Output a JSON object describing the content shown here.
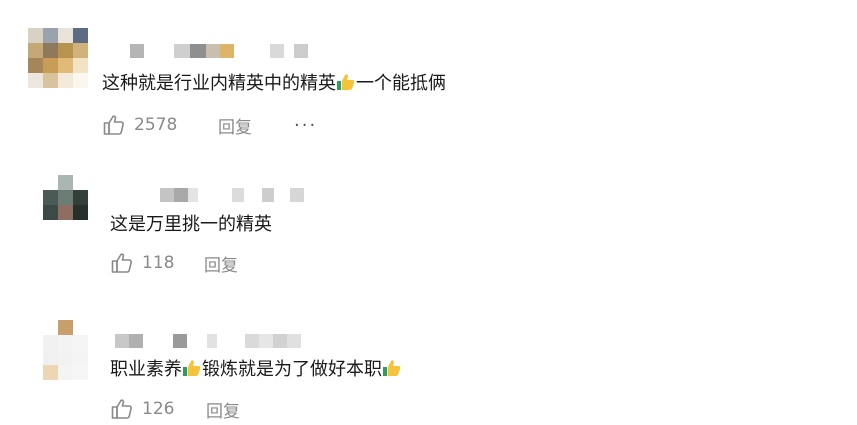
{
  "comments": [
    {
      "text_parts": [
        "这种就是行业内精英中的精英",
        "一个能抵俩"
      ],
      "likes": "2578",
      "reply_label": "回复",
      "more_label": "···",
      "emoji": "thumbs-up-emoji"
    },
    {
      "text_parts": [
        "这是万里挑一的精英"
      ],
      "likes": "118",
      "reply_label": "回复"
    },
    {
      "text_parts": [
        "职业素养",
        "锻炼就是为了做好本职",
        ""
      ],
      "likes": "126",
      "reply_label": "回复",
      "emoji": "thumbs-up-emoji"
    }
  ],
  "icons": {
    "like": "thumbs-up-outline-icon",
    "more": "more-dots-icon"
  },
  "colors": {
    "text": "#1a1a1a",
    "meta": "#8a8a8a",
    "background": "#ffffff"
  }
}
